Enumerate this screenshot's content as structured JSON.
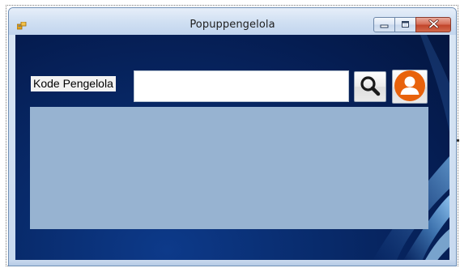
{
  "window": {
    "title": "Popuppengelola",
    "title_icon": "app-form-icon",
    "caption_buttons": {
      "minimize_icon": "minimize-icon",
      "maximize_icon": "maximize-icon",
      "close_icon": "close-icon"
    }
  },
  "form": {
    "kode_label": "Kode Pengelola",
    "kode_value": "",
    "search_button_icon": "search-icon",
    "user_button_icon": "user-icon"
  },
  "colors": {
    "grid_background": "#97b3d1",
    "user_icon_orange": "#e8620c",
    "client_background": "#082a6a"
  }
}
